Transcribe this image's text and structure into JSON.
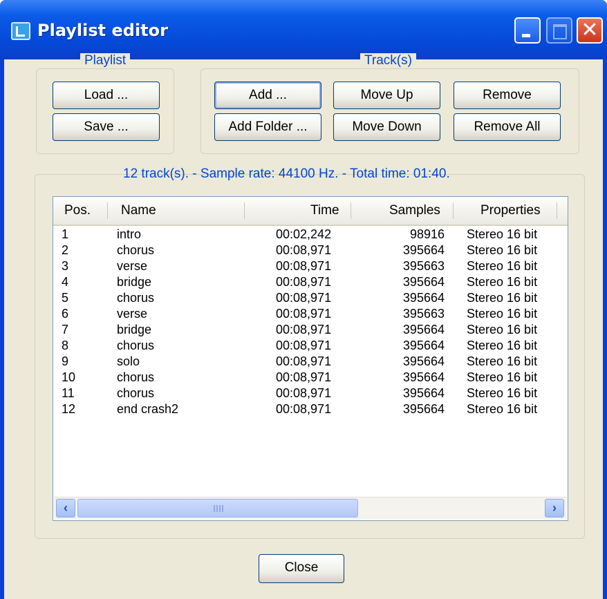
{
  "window": {
    "title": "Playlist editor",
    "title_buttons": [
      "minimize-icon",
      "maximize-icon",
      "close-icon"
    ]
  },
  "playlist_group": {
    "legend": "Playlist",
    "load_label": "Load ...",
    "save_label": "Save ..."
  },
  "tracks_group": {
    "legend": "Track(s)",
    "add_label": "Add ...",
    "add_folder_label": "Add Folder ...",
    "move_up_label": "Move Up",
    "move_down_label": "Move Down",
    "remove_label": "Remove",
    "remove_all_label": "Remove All"
  },
  "status": "12 track(s). - Sample rate: 44100 Hz. - Total time:   01:40.",
  "table": {
    "columns": [
      "Pos.",
      "Name",
      "Time",
      "Samples",
      "Properties"
    ],
    "rows": [
      {
        "pos": "1",
        "name": "intro",
        "time": "00:02,242",
        "samples": "98916",
        "properties": "Stereo 16 bit"
      },
      {
        "pos": "2",
        "name": "chorus",
        "time": "00:08,971",
        "samples": "395664",
        "properties": "Stereo 16 bit"
      },
      {
        "pos": "3",
        "name": "verse",
        "time": "00:08,971",
        "samples": "395663",
        "properties": "Stereo 16 bit"
      },
      {
        "pos": "4",
        "name": "bridge",
        "time": "00:08,971",
        "samples": "395664",
        "properties": "Stereo 16 bit"
      },
      {
        "pos": "5",
        "name": "chorus",
        "time": "00:08,971",
        "samples": "395664",
        "properties": "Stereo 16 bit"
      },
      {
        "pos": "6",
        "name": "verse",
        "time": "00:08,971",
        "samples": "395663",
        "properties": "Stereo 16 bit"
      },
      {
        "pos": "7",
        "name": "bridge",
        "time": "00:08,971",
        "samples": "395664",
        "properties": "Stereo 16 bit"
      },
      {
        "pos": "8",
        "name": "chorus",
        "time": "00:08,971",
        "samples": "395664",
        "properties": "Stereo 16 bit"
      },
      {
        "pos": "9",
        "name": "solo",
        "time": "00:08,971",
        "samples": "395664",
        "properties": "Stereo 16 bit"
      },
      {
        "pos": "10",
        "name": "chorus",
        "time": "00:08,971",
        "samples": "395664",
        "properties": "Stereo 16 bit"
      },
      {
        "pos": "11",
        "name": "chorus",
        "time": "00:08,971",
        "samples": "395664",
        "properties": "Stereo 16 bit"
      },
      {
        "pos": "12",
        "name": "end crash2",
        "time": "00:08,971",
        "samples": "395664",
        "properties": "Stereo 16 bit"
      }
    ]
  },
  "close_label": "Close",
  "colors": {
    "titlebar": "#0649d9",
    "dialog_bg": "#ece9d8",
    "group_label": "#0046d5",
    "close_button": "#c7371b"
  }
}
